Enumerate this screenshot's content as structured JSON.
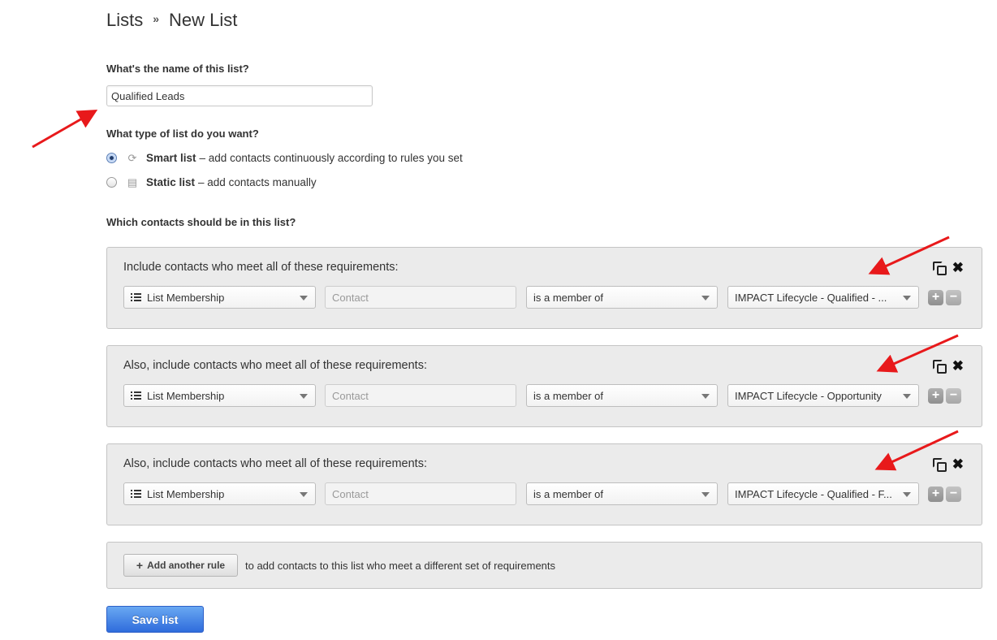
{
  "breadcrumb": {
    "parent": "Lists",
    "separator": "»",
    "current": "New List"
  },
  "name_section": {
    "label": "What's the name of this list?",
    "value": "Qualified Leads"
  },
  "type_section": {
    "label": "What type of list do you want?",
    "options": [
      {
        "name": "Smart list",
        "description": "– add contacts continuously according to rules you set",
        "icon": "refresh-icon",
        "selected": true
      },
      {
        "name": "Static list",
        "description": "– add contacts manually",
        "icon": "document-icon",
        "selected": false
      }
    ]
  },
  "contacts_section": {
    "label": "Which contacts should be in this list?",
    "rule_groups": [
      {
        "title": "Include contacts who meet all of these requirements:",
        "filter_type": "List Membership",
        "object_placeholder": "Contact",
        "operator": "is a member of",
        "value": "IMPACT Lifecycle - Qualified - ..."
      },
      {
        "title": "Also, include contacts who meet all of these requirements:",
        "filter_type": "List Membership",
        "object_placeholder": "Contact",
        "operator": "is a member of",
        "value": "IMPACT Lifecycle - Opportunity"
      },
      {
        "title": "Also, include contacts who meet all of these requirements:",
        "filter_type": "List Membership",
        "object_placeholder": "Contact",
        "operator": "is a member of",
        "value": "IMPACT Lifecycle - Qualified - F..."
      }
    ],
    "add_rule": {
      "button_label": "Add another rule",
      "description": "to add contacts to this list who meet a different set of requirements"
    }
  },
  "save_button": {
    "label": "Save list"
  },
  "annotation_color": "#e8191b"
}
